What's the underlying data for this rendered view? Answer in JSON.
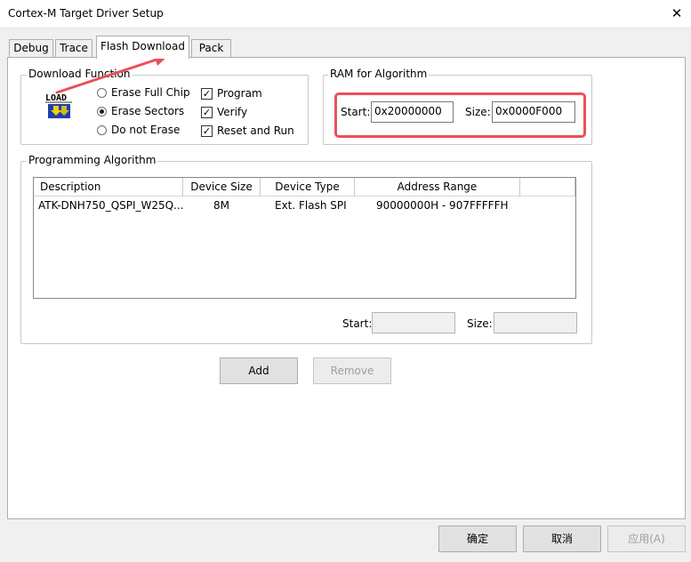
{
  "window": {
    "title": "Cortex-M Target Driver Setup",
    "close_glyph": "✕"
  },
  "tabs": [
    {
      "label": "Debug"
    },
    {
      "label": "Trace"
    },
    {
      "label": "Flash Download"
    },
    {
      "label": "Pack"
    }
  ],
  "download_function": {
    "legend": "Download Function",
    "icon": "load-icon",
    "icon_text": "LOAD",
    "radios": [
      {
        "label": "Erase Full Chip",
        "checked": false
      },
      {
        "label": "Erase Sectors",
        "checked": true
      },
      {
        "label": "Do not Erase",
        "checked": false
      }
    ],
    "checkboxes": [
      {
        "label": "Program",
        "checked": true
      },
      {
        "label": "Verify",
        "checked": true
      },
      {
        "label": "Reset and Run",
        "checked": true
      }
    ]
  },
  "ram_for_algorithm": {
    "legend": "RAM for Algorithm",
    "start_label": "Start:",
    "start_value": "0x20000000",
    "size_label": "Size:",
    "size_value": "0x0000F000"
  },
  "programming_algorithm": {
    "legend": "Programming Algorithm",
    "columns": [
      "Description",
      "Device Size",
      "Device Type",
      "Address Range"
    ],
    "rows": [
      [
        "ATK-DNH750_QSPI_W25Q...",
        "8M",
        "Ext. Flash SPI",
        "90000000H - 907FFFFFH"
      ]
    ],
    "start_label": "Start:",
    "start_value": "",
    "size_label": "Size:",
    "size_value": ""
  },
  "buttons": {
    "add": "Add",
    "remove": "Remove",
    "ok": "确定",
    "cancel": "取消",
    "apply": "应用(A)"
  },
  "colors": {
    "annotation": "#e8505b"
  }
}
